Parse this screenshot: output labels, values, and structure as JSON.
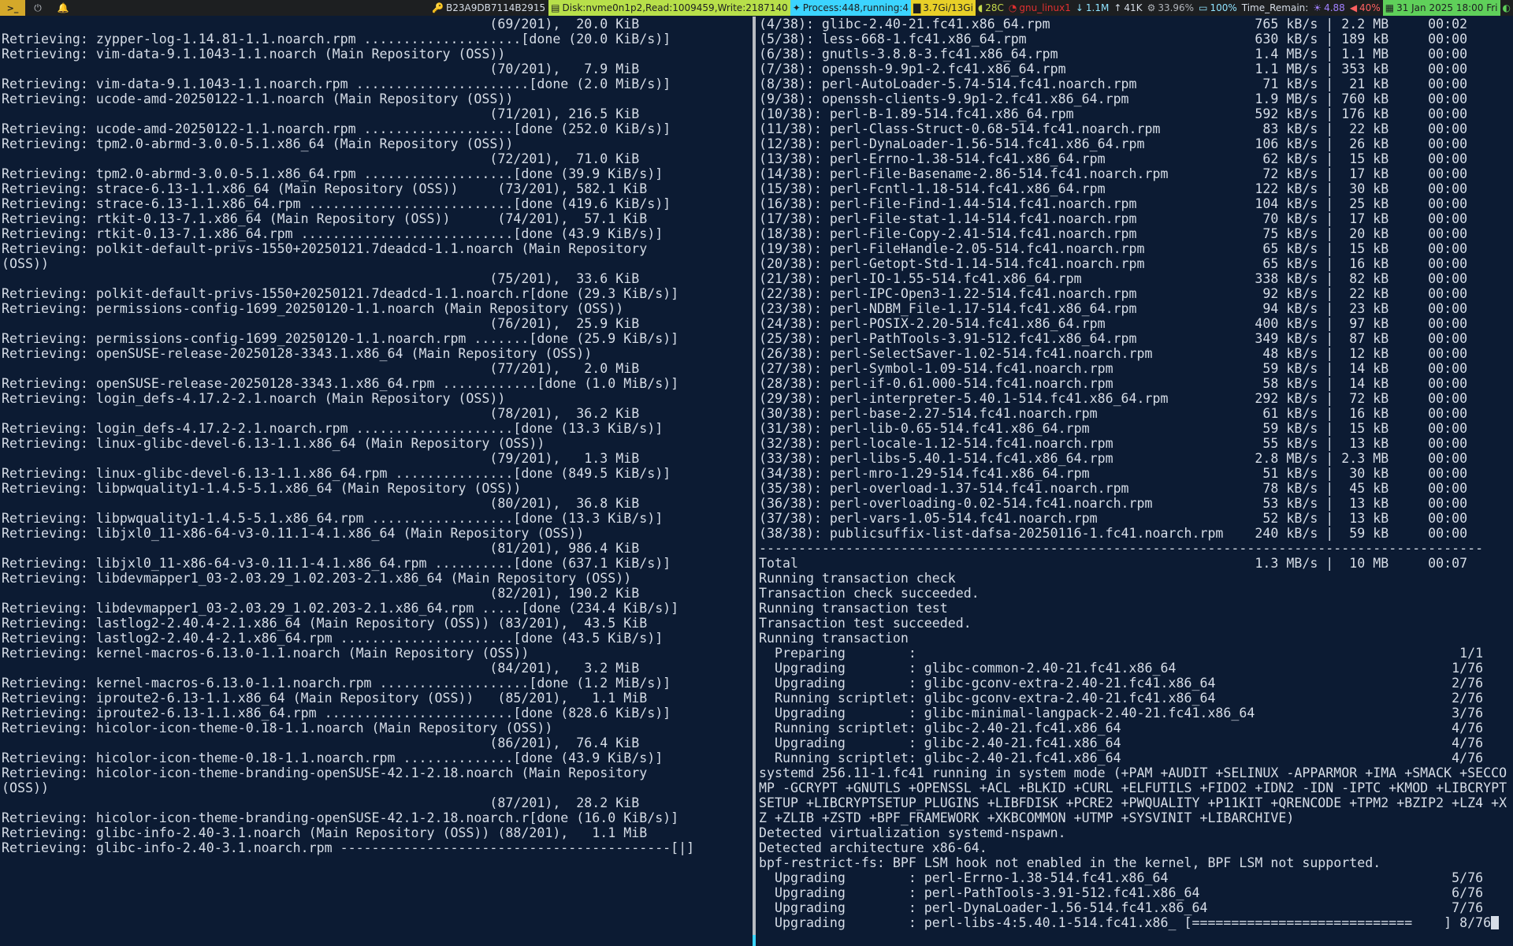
{
  "topbar": {
    "launcher": ">_",
    "host": "B23A9DB7114B2915",
    "disk": "Disk:nvme0n1p2,Read:1009459,Write:2187140",
    "process": "Process:448,running:4",
    "memory": "3.7Gi/13Gi",
    "temp": "28C",
    "net_iface": "gnu_linux1",
    "net_down": "1.1M",
    "net_up": "41K",
    "cpu": "33.96%",
    "battery": "100%",
    "time_remain": "Time_Remain:",
    "load": "4.88",
    "volume": "40%",
    "date": "31 Jan 2025 18:00 Fri"
  },
  "left_lines": [
    "                                                              (69/201),  20.0 KiB",
    "Retrieving: zypper-log-1.14.81-1.1.noarch.rpm ....................[done (20.0 KiB/s)]",
    "Retrieving: vim-data-9.1.1043-1.1.noarch (Main Repository (OSS))",
    "                                                              (70/201),   7.9 MiB",
    "Retrieving: vim-data-9.1.1043-1.1.noarch.rpm ......................[done (2.0 MiB/s)]",
    "Retrieving: ucode-amd-20250122-1.1.noarch (Main Repository (OSS))",
    "                                                              (71/201), 216.5 KiB",
    "Retrieving: ucode-amd-20250122-1.1.noarch.rpm ...................[done (252.0 KiB/s)]",
    "Retrieving: tpm2.0-abrmd-3.0.0-5.1.x86_64 (Main Repository (OSS))",
    "                                                              (72/201),  71.0 KiB",
    "Retrieving: tpm2.0-abrmd-3.0.0-5.1.x86_64.rpm ...................[done (39.9 KiB/s)]",
    "Retrieving: strace-6.13-1.1.x86_64 (Main Repository (OSS))     (73/201), 582.1 KiB",
    "Retrieving: strace-6.13-1.1.x86_64.rpm ..........................[done (419.6 KiB/s)]",
    "Retrieving: rtkit-0.13-7.1.x86_64 (Main Repository (OSS))      (74/201),  57.1 KiB",
    "Retrieving: rtkit-0.13-7.1.x86_64.rpm ...........................[done (43.9 KiB/s)]",
    "Retrieving: polkit-default-privs-1550+20250121.7deadcd-1.1.noarch (Main Repository",
    "(OSS))",
    "                                                              (75/201),  33.6 KiB",
    "Retrieving: polkit-default-privs-1550+20250121.7deadcd-1.1.noarch.r[done (29.3 KiB/s)]",
    "Retrieving: permissions-config-1699_20250120-1.1.noarch (Main Repository (OSS))",
    "                                                              (76/201),  25.9 KiB",
    "Retrieving: permissions-config-1699_20250120-1.1.noarch.rpm .......[done (25.9 KiB/s)]",
    "Retrieving: openSUSE-release-20250128-3343.1.x86_64 (Main Repository (OSS))",
    "                                                              (77/201),   2.0 MiB",
    "Retrieving: openSUSE-release-20250128-3343.1.x86_64.rpm ............[done (1.0 MiB/s)]",
    "Retrieving: login_defs-4.17.2-2.1.noarch (Main Repository (OSS))",
    "                                                              (78/201),  36.2 KiB",
    "Retrieving: login_defs-4.17.2-2.1.noarch.rpm ....................[done (13.3 KiB/s)]",
    "Retrieving: linux-glibc-devel-6.13-1.1.x86_64 (Main Repository (OSS))",
    "                                                              (79/201),   1.3 MiB",
    "Retrieving: linux-glibc-devel-6.13-1.1.x86_64.rpm ...............[done (849.5 KiB/s)]",
    "Retrieving: libpwquality1-1.4.5-5.1.x86_64 (Main Repository (OSS))",
    "                                                              (80/201),  36.8 KiB",
    "Retrieving: libpwquality1-1.4.5-5.1.x86_64.rpm ..................[done (13.3 KiB/s)]",
    "Retrieving: libjxl0_11-x86-64-v3-0.11.1-4.1.x86_64 (Main Repository (OSS))",
    "                                                              (81/201), 986.4 KiB",
    "Retrieving: libjxl0_11-x86-64-v3-0.11.1-4.1.x86_64.rpm ..........[done (637.1 KiB/s)]",
    "Retrieving: libdevmapper1_03-2.03.29_1.02.203-2.1.x86_64 (Main Repository (OSS))",
    "                                                              (82/201), 190.2 KiB",
    "Retrieving: libdevmapper1_03-2.03.29_1.02.203-2.1.x86_64.rpm .....[done (234.4 KiB/s)]",
    "Retrieving: lastlog2-2.40.4-2.1.x86_64 (Main Repository (OSS)) (83/201),  43.5 KiB",
    "Retrieving: lastlog2-2.40.4-2.1.x86_64.rpm ......................[done (43.5 KiB/s)]",
    "Retrieving: kernel-macros-6.13.0-1.1.noarch (Main Repository (OSS))",
    "                                                              (84/201),   3.2 MiB",
    "Retrieving: kernel-macros-6.13.0-1.1.noarch.rpm ...................[done (1.2 MiB/s)]",
    "Retrieving: iproute2-6.13-1.1.x86_64 (Main Repository (OSS))   (85/201),   1.1 MiB",
    "Retrieving: iproute2-6.13-1.1.x86_64.rpm ........................[done (828.6 KiB/s)]",
    "Retrieving: hicolor-icon-theme-0.18-1.1.noarch (Main Repository (OSS))",
    "                                                              (86/201),  76.4 KiB",
    "Retrieving: hicolor-icon-theme-0.18-1.1.noarch.rpm ..............[done (43.9 KiB/s)]",
    "Retrieving: hicolor-icon-theme-branding-openSUSE-42.1-2.18.noarch (Main Repository",
    "(OSS))",
    "                                                              (87/201),  28.2 KiB",
    "Retrieving: hicolor-icon-theme-branding-openSUSE-42.1-2.18.noarch.r[done (16.0 KiB/s)]",
    "Retrieving: glibc-info-2.40-3.1.noarch (Main Repository (OSS)) (88/201),   1.1 MiB",
    "Retrieving: glibc-info-2.40-3.1.noarch.rpm ------------------------------------------[|]"
  ],
  "right_lines": [
    "(4/38): glibc-2.40-21.fc41.x86_64.rpm                          765 kB/s | 2.2 MB     00:02",
    "(5/38): less-668-1.fc41.x86_64.rpm                             630 kB/s | 189 kB     00:00",
    "(6/38): gnutls-3.8.8-3.fc41.x86_64.rpm                         1.4 MB/s | 1.1 MB     00:00",
    "(7/38): openssh-9.9p1-2.fc41.x86_64.rpm                        1.1 MB/s | 353 kB     00:00",
    "(8/38): perl-AutoLoader-5.74-514.fc41.noarch.rpm                71 kB/s |  21 kB     00:00",
    "(9/38): openssh-clients-9.9p1-2.fc41.x86_64.rpm                1.9 MB/s | 760 kB     00:00",
    "(10/38): perl-B-1.89-514.fc41.x86_64.rpm                       592 kB/s | 176 kB     00:00",
    "(11/38): perl-Class-Struct-0.68-514.fc41.noarch.rpm             83 kB/s |  22 kB     00:00",
    "(12/38): perl-DynaLoader-1.56-514.fc41.x86_64.rpm              106 kB/s |  26 kB     00:00",
    "(13/38): perl-Errno-1.38-514.fc41.x86_64.rpm                    62 kB/s |  15 kB     00:00",
    "(14/38): perl-File-Basename-2.86-514.fc41.noarch.rpm            72 kB/s |  17 kB     00:00",
    "(15/38): perl-Fcntl-1.18-514.fc41.x86_64.rpm                   122 kB/s |  30 kB     00:00",
    "(16/38): perl-File-Find-1.44-514.fc41.noarch.rpm               104 kB/s |  25 kB     00:00",
    "(17/38): perl-File-stat-1.14-514.fc41.noarch.rpm                70 kB/s |  17 kB     00:00",
    "(18/38): perl-File-Copy-2.41-514.fc41.noarch.rpm                75 kB/s |  20 kB     00:00",
    "(19/38): perl-FileHandle-2.05-514.fc41.noarch.rpm               65 kB/s |  15 kB     00:00",
    "(20/38): perl-Getopt-Std-1.14-514.fc41.noarch.rpm               65 kB/s |  16 kB     00:00",
    "(21/38): perl-IO-1.55-514.fc41.x86_64.rpm                      338 kB/s |  82 kB     00:00",
    "(22/38): perl-IPC-Open3-1.22-514.fc41.noarch.rpm                92 kB/s |  22 kB     00:00",
    "(23/38): perl-NDBM_File-1.17-514.fc41.x86_64.rpm                94 kB/s |  23 kB     00:00",
    "(24/38): perl-POSIX-2.20-514.fc41.x86_64.rpm                   400 kB/s |  97 kB     00:00",
    "(25/38): perl-PathTools-3.91-512.fc41.x86_64.rpm               349 kB/s |  87 kB     00:00",
    "(26/38): perl-SelectSaver-1.02-514.fc41.noarch.rpm              48 kB/s |  12 kB     00:00",
    "(27/38): perl-Symbol-1.09-514.fc41.noarch.rpm                   59 kB/s |  14 kB     00:00",
    "(28/38): perl-if-0.61.000-514.fc41.noarch.rpm                   58 kB/s |  14 kB     00:00",
    "(29/38): perl-interpreter-5.40.1-514.fc41.x86_64.rpm           292 kB/s |  72 kB     00:00",
    "(30/38): perl-base-2.27-514.fc41.noarch.rpm                     61 kB/s |  16 kB     00:00",
    "(31/38): perl-lib-0.65-514.fc41.x86_64.rpm                      59 kB/s |  15 kB     00:00",
    "(32/38): perl-locale-1.12-514.fc41.noarch.rpm                   55 kB/s |  13 kB     00:00",
    "(33/38): perl-libs-5.40.1-514.fc41.x86_64.rpm                  2.8 MB/s | 2.3 MB     00:00",
    "(34/38): perl-mro-1.29-514.fc41.x86_64.rpm                      51 kB/s |  30 kB     00:00",
    "(35/38): perl-overload-1.37-514.fc41.noarch.rpm                 78 kB/s |  45 kB     00:00",
    "(36/38): perl-overloading-0.02-514.fc41.noarch.rpm              53 kB/s |  13 kB     00:00",
    "(37/38): perl-vars-1.05-514.fc41.noarch.rpm                     52 kB/s |  13 kB     00:00",
    "(38/38): publicsuffix-list-dafsa-20250116-1.fc41.noarch.rpm    240 kB/s |  59 kB     00:00",
    "--------------------------------------------------------------------------------------------",
    "Total                                                          1.3 MB/s |  10 MB     00:07",
    "Running transaction check",
    "Transaction check succeeded.",
    "Running transaction test",
    "Transaction test succeeded.",
    "Running transaction",
    "  Preparing        :                                                                     1/1",
    "  Upgrading        : glibc-common-2.40-21.fc41.x86_64                                   1/76",
    "  Upgrading        : glibc-gconv-extra-2.40-21.fc41.x86_64                              2/76",
    "  Running scriptlet: glibc-gconv-extra-2.40-21.fc41.x86_64                              2/76",
    "  Upgrading        : glibc-minimal-langpack-2.40-21.fc41.x86_64                         3/76",
    "  Running scriptlet: glibc-2.40-21.fc41.x86_64                                          4/76",
    "  Upgrading        : glibc-2.40-21.fc41.x86_64                                          4/76",
    "  Running scriptlet: glibc-2.40-21.fc41.x86_64                                          4/76",
    "systemd 256.11-1.fc41 running in system mode (+PAM +AUDIT +SELINUX -APPARMOR +IMA +SMACK +SECCO",
    "MP -GCRYPT +GNUTLS +OPENSSL +ACL +BLKID +CURL +ELFUTILS +FIDO2 +IDN2 -IDN -IPTC +KMOD +LIBCRYPT",
    "SETUP +LIBCRYPTSETUP_PLUGINS +LIBFDISK +PCRE2 +PWQUALITY +P11KIT +QRENCODE +TPM2 +BZIP2 +LZ4 +X",
    "Z +ZLIB +ZSTD +BPF_FRAMEWORK +XKBCOMMON +UTMP +SYSVINIT +LIBARCHIVE)",
    "Detected virtualization systemd-nspawn.",
    "Detected architecture x86-64.",
    "bpf-restrict-fs: BPF LSM hook not enabled in the kernel, BPF LSM not supported.",
    "  Upgrading        : perl-Errno-1.38-514.fc41.x86_64                                    5/76",
    "  Upgrading        : perl-PathTools-3.91-512.fc41.x86_64                                6/76",
    "  Upgrading        : perl-DynaLoader-1.56-514.fc41.x86_64                               7/76",
    "  Upgrading        : perl-libs-4:5.40.1-514.fc41.x86_ [============================    ] 8/76"
  ]
}
